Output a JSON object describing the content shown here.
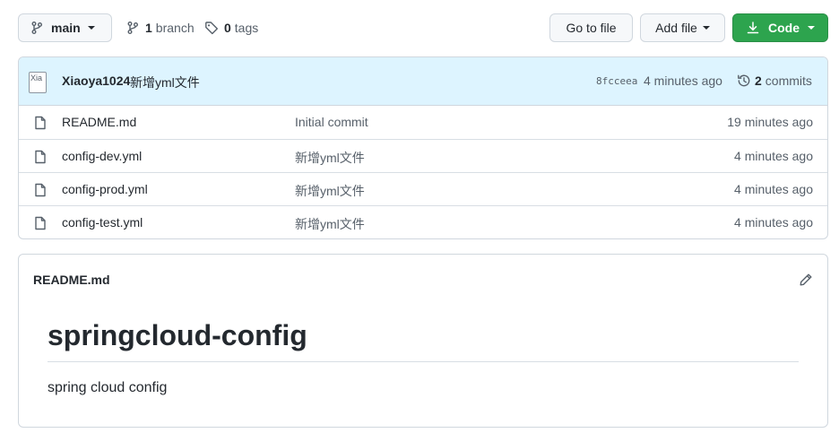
{
  "toolbar": {
    "branch_label": "main",
    "branch_count": "1",
    "branch_word": "branch",
    "tag_count": "0",
    "tag_word": "tags",
    "goto_label": "Go to file",
    "addfile_label": "Add file",
    "code_label": "Code",
    "code_color": "#2da44e"
  },
  "commit": {
    "avatar_alt": "Xia",
    "author": "Xiaoya1024",
    "message": "新增yml文件",
    "sha": "8fcceea",
    "time": "4 minutes ago",
    "commit_count": "2",
    "commit_word": "commits"
  },
  "files": [
    {
      "name": "README.md",
      "message": "Initial commit",
      "time": "19 minutes ago",
      "icon": "file-icon"
    },
    {
      "name": "config-dev.yml",
      "message": "新增yml文件",
      "time": "4 minutes ago",
      "icon": "file-icon"
    },
    {
      "name": "config-prod.yml",
      "message": "新增yml文件",
      "time": "4 minutes ago",
      "icon": "file-icon"
    },
    {
      "name": "config-test.yml",
      "message": "新增yml文件",
      "time": "4 minutes ago",
      "icon": "file-icon"
    }
  ],
  "readme": {
    "filename": "README.md",
    "heading": "springcloud-config",
    "body": "spring cloud config"
  }
}
